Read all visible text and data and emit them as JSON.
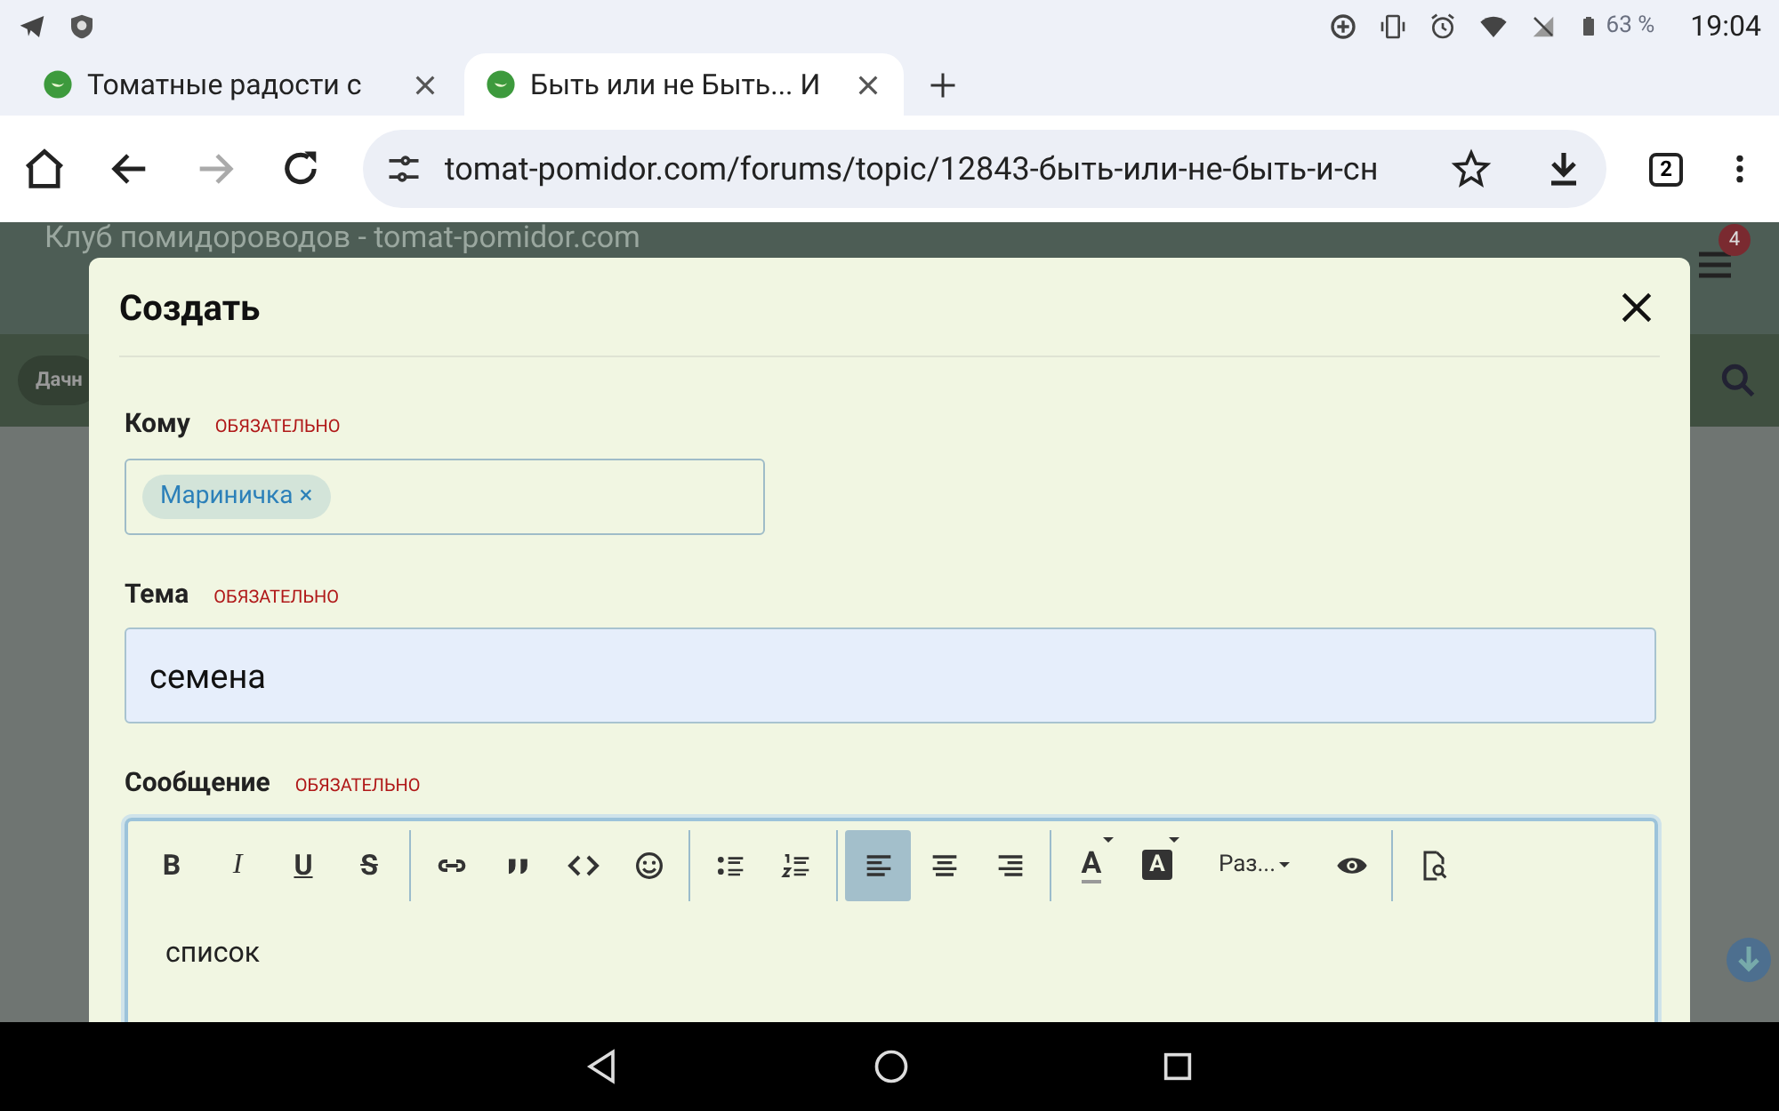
{
  "status_bar": {
    "battery": "63 %",
    "time": "19:04"
  },
  "tabs": [
    {
      "title": "Томатные радости с",
      "selected": false
    },
    {
      "title": "Быть или не Быть... И",
      "selected": true
    }
  ],
  "address_bar": {
    "url": "tomat-pomidor.com/forums/topic/12843-быть-или-не-быть-и-сн",
    "tab_count": "2"
  },
  "background_page": {
    "site_title": "Клуб помидороводов - tomat-pomidor.com",
    "notification_count": "4",
    "nav_chip": "Дачн"
  },
  "dialog": {
    "title": "Создать",
    "fields": [
      {
        "label": "Кому",
        "required": "ОБЯЗАТЕЛЬНО",
        "kind": "recipients",
        "tokens": [
          "Мариничка ×"
        ]
      },
      {
        "label": "Тема",
        "required": "ОБЯЗАТЕЛЬНО",
        "kind": "text",
        "value": "семена"
      },
      {
        "label": "Сообщение",
        "required": "ОБЯЗАТЕЛЬНО",
        "kind": "editor",
        "value": "список"
      }
    ],
    "toolbar": [
      [
        {
          "kind": "bold",
          "label": "B",
          "selected": false
        },
        {
          "kind": "italic",
          "label": "I",
          "selected": false
        },
        {
          "kind": "underline",
          "label": "U",
          "selected": false
        },
        {
          "kind": "strike",
          "label": "S",
          "selected": false
        }
      ],
      [
        {
          "kind": "link",
          "selected": false
        },
        {
          "kind": "quote",
          "selected": false
        },
        {
          "kind": "code",
          "selected": false
        },
        {
          "kind": "emoji",
          "selected": false
        }
      ],
      [
        {
          "kind": "bullets",
          "selected": false
        },
        {
          "kind": "numbers",
          "selected": false
        }
      ],
      [
        {
          "kind": "align-left",
          "selected": true
        },
        {
          "kind": "align-center",
          "selected": false
        },
        {
          "kind": "align-right",
          "selected": false
        }
      ],
      [
        {
          "kind": "text-color",
          "label": "A",
          "selected": false
        },
        {
          "kind": "bg-color",
          "label": "A",
          "selected": false
        },
        {
          "kind": "size",
          "label": "Раз...",
          "selected": false
        },
        {
          "kind": "preview",
          "selected": false
        }
      ],
      [
        {
          "kind": "doc-search",
          "selected": false
        }
      ]
    ]
  }
}
